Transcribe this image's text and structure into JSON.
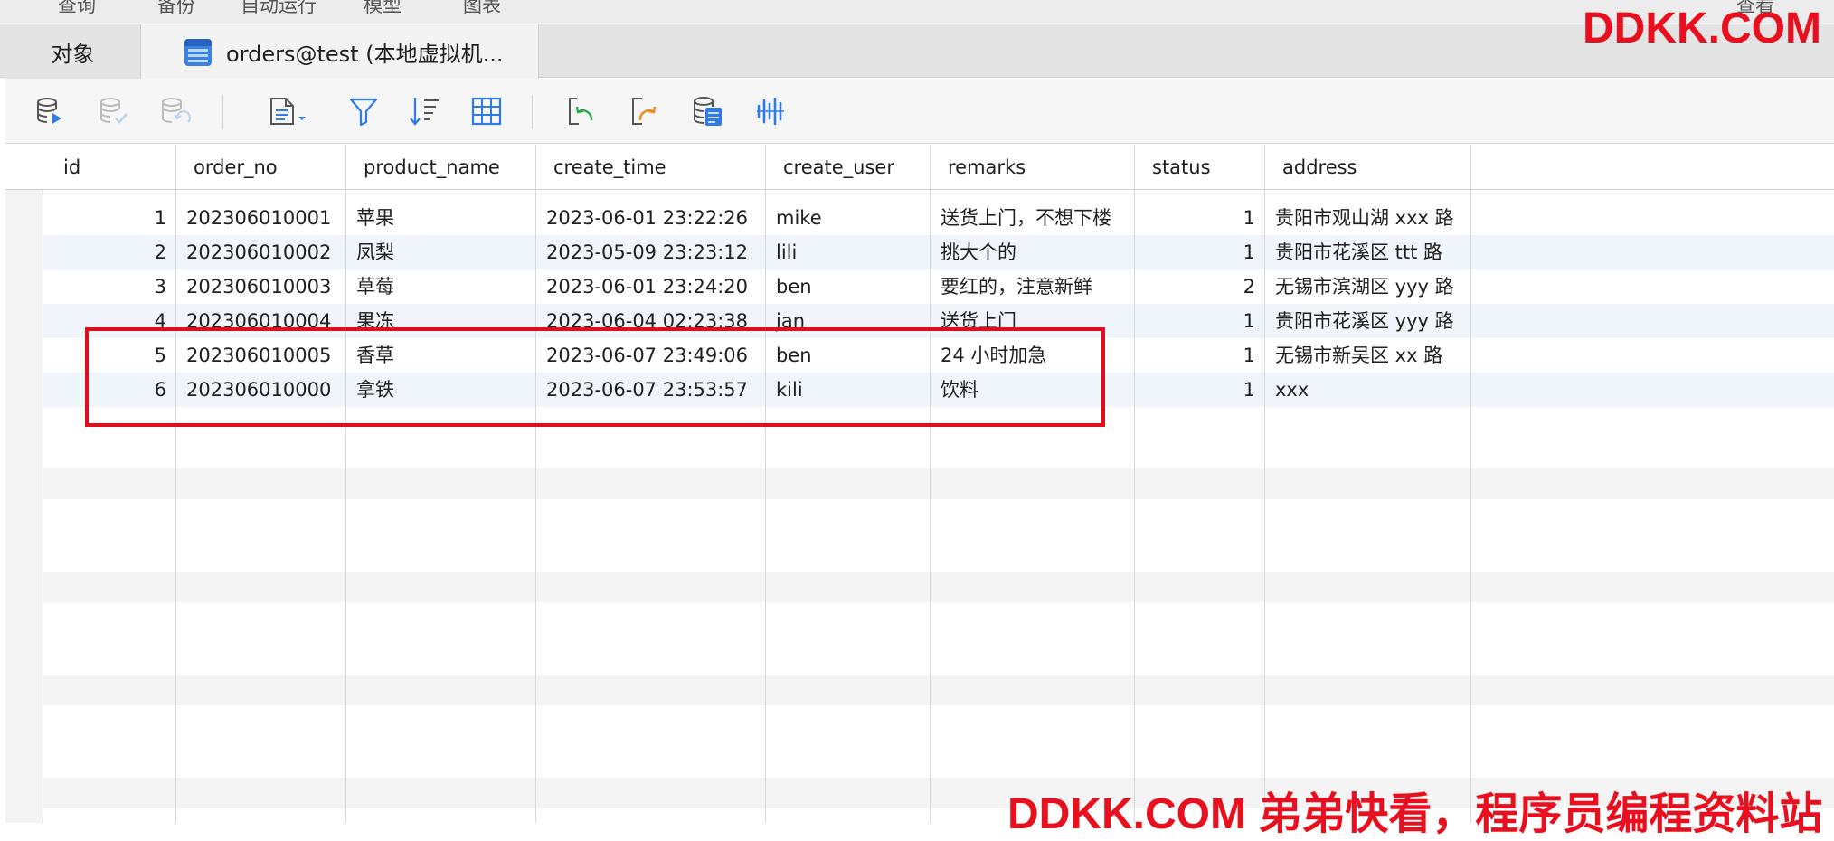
{
  "menu": {
    "items": [
      "查询",
      "备份",
      "自动运行",
      "模型",
      "图表",
      "查看"
    ]
  },
  "tabs": {
    "objects_label": "对象",
    "table_tab_label": "orders@test (本地虚拟机..."
  },
  "toolbar": {
    "buttons": [
      "add-record",
      "apply-changes",
      "discard-changes",
      "text-view",
      "filter",
      "sort",
      "grid-view",
      "import",
      "export",
      "data-generation",
      "profile"
    ]
  },
  "grid": {
    "columns": [
      "id",
      "order_no",
      "product_name",
      "create_time",
      "create_user",
      "remarks",
      "status",
      "address"
    ],
    "rows": [
      [
        "1",
        "202306010001",
        "苹果",
        "2023-06-01 23:22:26",
        "mike",
        "送货上门，不想下楼",
        "1",
        "贵阳市观山湖 xxx 路"
      ],
      [
        "2",
        "202306010002",
        "凤梨",
        "2023-05-09 23:23:12",
        "lili",
        "挑大个的",
        "1",
        "贵阳市花溪区 ttt 路"
      ],
      [
        "3",
        "202306010003",
        "草莓",
        "2023-06-01 23:24:20",
        "ben",
        "要红的，注意新鲜",
        "2",
        "无锡市滨湖区 yyy 路"
      ],
      [
        "4",
        "202306010004",
        "果冻",
        "2023-06-04 02:23:38",
        "jan",
        "送货上门",
        "1",
        "贵阳市花溪区 yyy 路"
      ],
      [
        "5",
        "202306010005",
        "香草",
        "2023-06-07 23:49:06",
        "ben",
        "24 小时加急",
        "1",
        "无锡市新吴区 xx 路"
      ],
      [
        "6",
        "202306010000",
        "拿铁",
        "2023-06-07 23:53:57",
        "kili",
        "饮料",
        "1",
        "xxx"
      ]
    ]
  },
  "watermark": {
    "top": "DDKK.COM",
    "bottom": "DDKK.COM 弟弟快看，程序员编程资料站"
  },
  "colors": {
    "highlight": "#e00d1c",
    "watermark": "#e8101e",
    "accent_blue": "#2f7be6"
  }
}
